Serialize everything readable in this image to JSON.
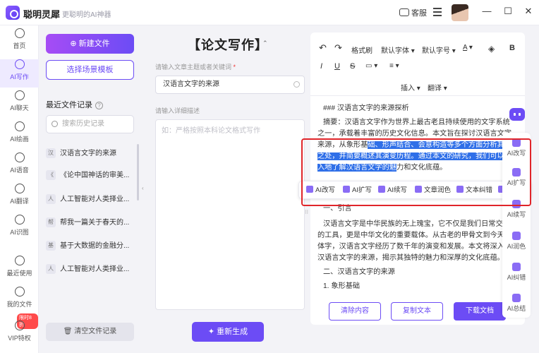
{
  "app": {
    "name": "聪明灵犀",
    "slogan": "更聪明的AI神器",
    "service": "客服"
  },
  "nav": [
    {
      "label": "首页",
      "icon": "home-icon"
    },
    {
      "label": "AI写作",
      "icon": "pen-icon",
      "active": true
    },
    {
      "label": "AI聊天",
      "icon": "chat-icon"
    },
    {
      "label": "AI绘画",
      "icon": "brush-icon"
    },
    {
      "label": "AI语音",
      "icon": "headset-icon"
    },
    {
      "label": "AI翻译",
      "icon": "translate-icon"
    },
    {
      "label": "AI识图",
      "icon": "scan-icon"
    },
    {
      "label": "最近使用",
      "icon": "history-icon"
    },
    {
      "label": "我的文件",
      "icon": "file-icon"
    },
    {
      "label": "VIP特权",
      "icon": "vip-icon"
    }
  ],
  "vip_badge": "限时8折",
  "sidebar": {
    "new_file": "新建文件",
    "select_template": "选择场景模板",
    "recent_title": "最近文件记录",
    "search_placeholder": "搜索历史记录",
    "history": [
      {
        "tag": "汉",
        "title": "汉语言文字的来源"
      },
      {
        "tag": "《",
        "title": "《论中国神话的审美..."
      },
      {
        "tag": "人",
        "title": "人工智能对人类择业..."
      },
      {
        "tag": "帮",
        "title": "帮我一篇关于春天的..."
      },
      {
        "tag": "基",
        "title": "基于大数据的金融分..."
      },
      {
        "tag": "人",
        "title": "人工智能对人类择业..."
      }
    ],
    "clear": "清空文件记录"
  },
  "form": {
    "title": "【论文写作】",
    "topic_label": "请输入文章主题或者关键词",
    "topic_value": "汉语言文字的来源",
    "desc_label": "请输入详细描述",
    "desc_placeholder": "如：严格按照本科论文格式写作",
    "regenerate": "重新生成"
  },
  "editor": {
    "toolbar_row1": [
      "格式刷",
      "默认字体",
      "默认字号",
      "B"
    ],
    "toolbar_row2": [
      "I",
      "U",
      "S"
    ],
    "toolbar_row3": [
      "插入",
      "翻译"
    ],
    "doc": {
      "heading": "### 汉语言文字的来源探析",
      "abs1": "摘要：汉语言文字作为世界上最古老且持续使用的文字系统",
      "abs2": "之一，承载着丰富的历史文化信息。本文旨在探讨汉语言文字",
      "abs3a": "来源，从象形基",
      "abs3b": "础、形声结合、会意构造等多个方面分析其独到",
      "abs4": "之处，并简要概述其演变历程。通过本文的研究，我们可以更",
      "abs5a": "入地了解汉语言文字的魅",
      "abs5b": "力和文化底蕴。",
      "sec1": "一、引言",
      "p1": "汉语言文字是中华民族的无上瑰宝，它不仅是我们日常交流",
      "p2": "的工具，更是中华文化的重要载体。从古老的甲骨文到今天的",
      "p3": "体字，汉语言文字经历了数千年的演变和发展。本文将深入探",
      "p4": "汉语言文字的来源，揭示其独特的魅力和深厚的文化底蕴。",
      "sec2": "二、汉语言文字的来源",
      "sec3": "1. 象形基础"
    },
    "clear_btn": "清除内容",
    "copy_btn": "复制文本",
    "download_btn": "下载文档"
  },
  "float_bar": [
    "AI改写",
    "AI扩写",
    "AI续写",
    "文章润色",
    "文本纠错",
    "翻译"
  ],
  "ai_panel": [
    "AI改写",
    "AI扩写",
    "AI续写",
    "AI润色",
    "AI纠错",
    "AI总结"
  ],
  "accent": "#6c4cf5",
  "highlight": "#2f6fe8",
  "annotation": "#e0252a"
}
